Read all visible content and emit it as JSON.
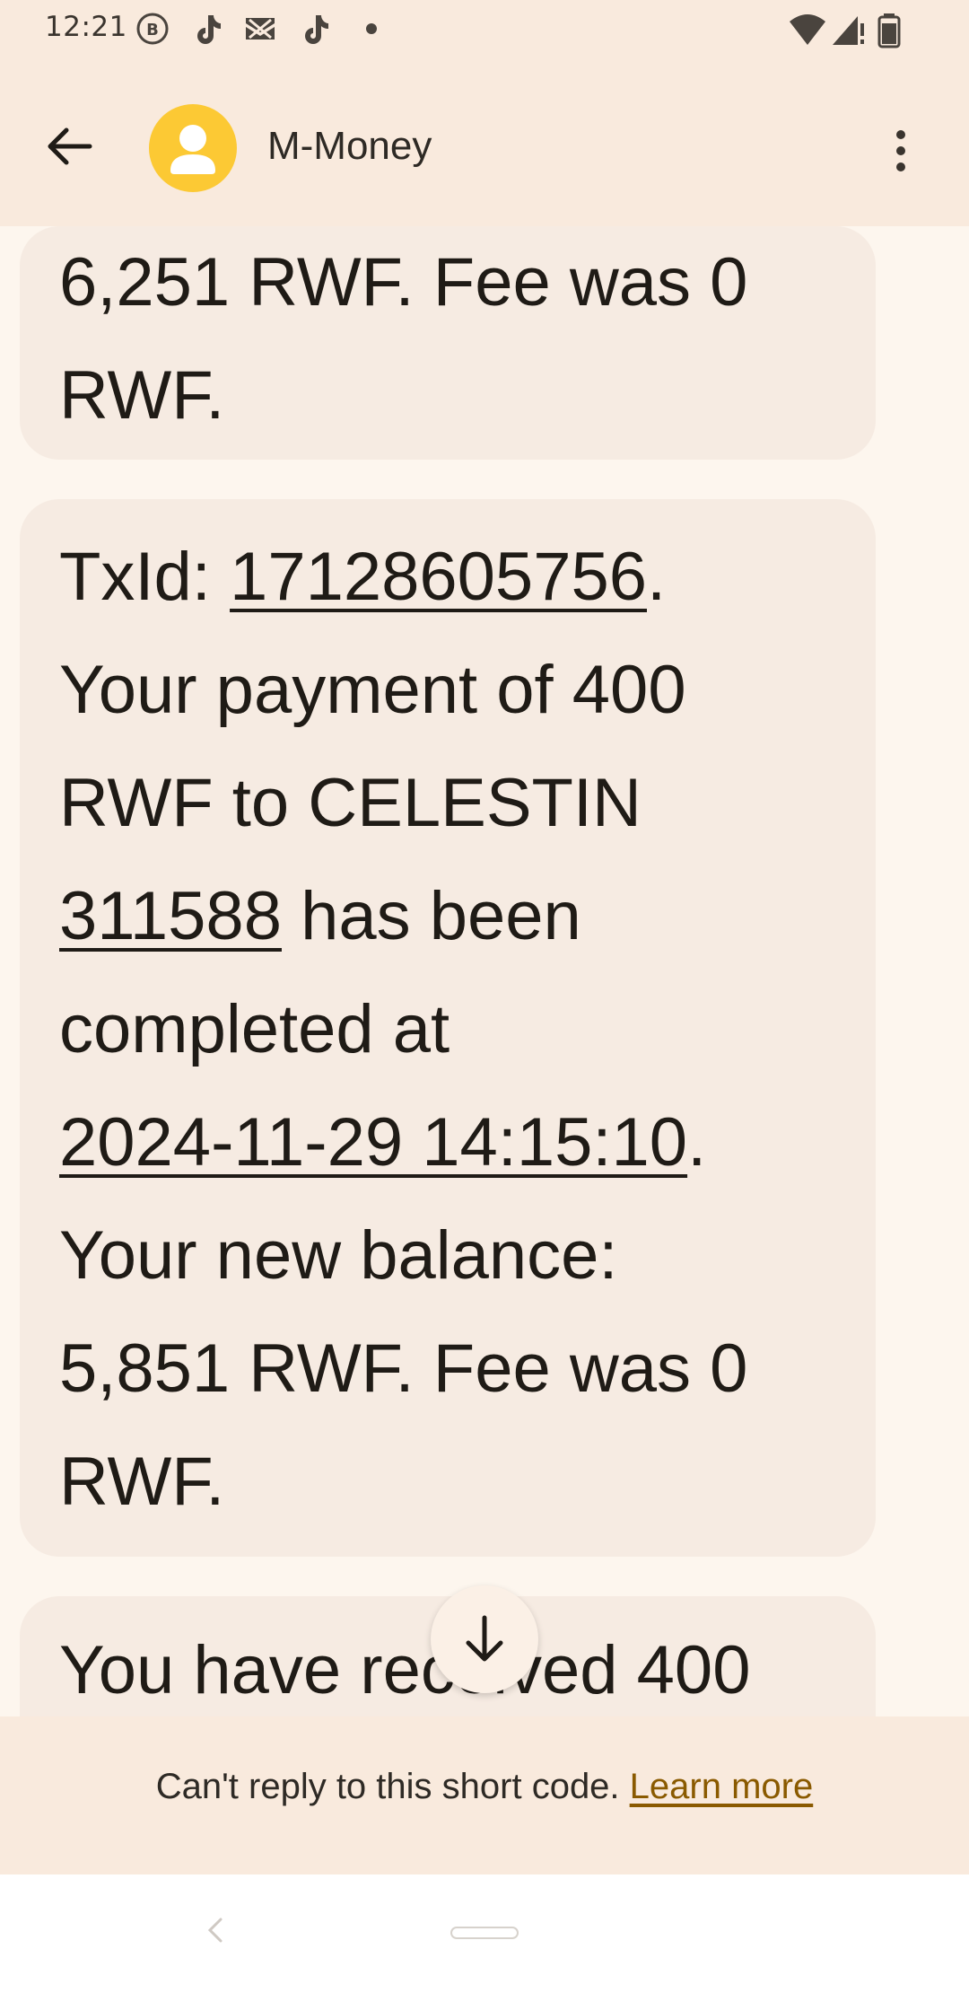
{
  "status_bar": {
    "time": "12:21",
    "icons_left": [
      "b-circle-icon",
      "tiktok-icon",
      "x-mail-icon",
      "tiktok-icon",
      "dot-icon"
    ],
    "icons_right": [
      "wifi-icon",
      "signal-icon",
      "battery-icon"
    ]
  },
  "header": {
    "contact_name": "M-Money",
    "avatar_color": "#fcc934"
  },
  "messages": [
    {
      "lines": [
        [
          {
            "t": "6,251 RWF. Fee was 0"
          }
        ],
        [
          {
            "t": "RWF."
          }
        ]
      ]
    },
    {
      "lines": [
        [
          {
            "t": "TxId: "
          },
          {
            "t": "17128605756",
            "link": true
          },
          {
            "t": "."
          }
        ],
        [
          {
            "t": "Your payment of 400"
          }
        ],
        [
          {
            "t": "RWF to CELESTIN"
          }
        ],
        [
          {
            "t": "311588",
            "link": true
          },
          {
            "t": " has been"
          }
        ],
        [
          {
            "t": "completed at"
          }
        ],
        [
          {
            "t": "2024-11-29 14:15:10",
            "link": true
          },
          {
            "t": "."
          }
        ],
        [
          {
            "t": "Your new balance:"
          }
        ],
        [
          {
            "t": "5,851 RWF. Fee was 0"
          }
        ],
        [
          {
            "t": "RWF."
          }
        ]
      ]
    },
    {
      "lines": [
        [
          {
            "t": "You have received 400"
          }
        ]
      ]
    }
  ],
  "footer": {
    "notice": "Can't reply to this short code.",
    "learn_more": "Learn more"
  },
  "colors": {
    "header_bg": "#f9eadd",
    "bubble_bg": "#f6ebe2",
    "link_color": "#8a5a00"
  }
}
